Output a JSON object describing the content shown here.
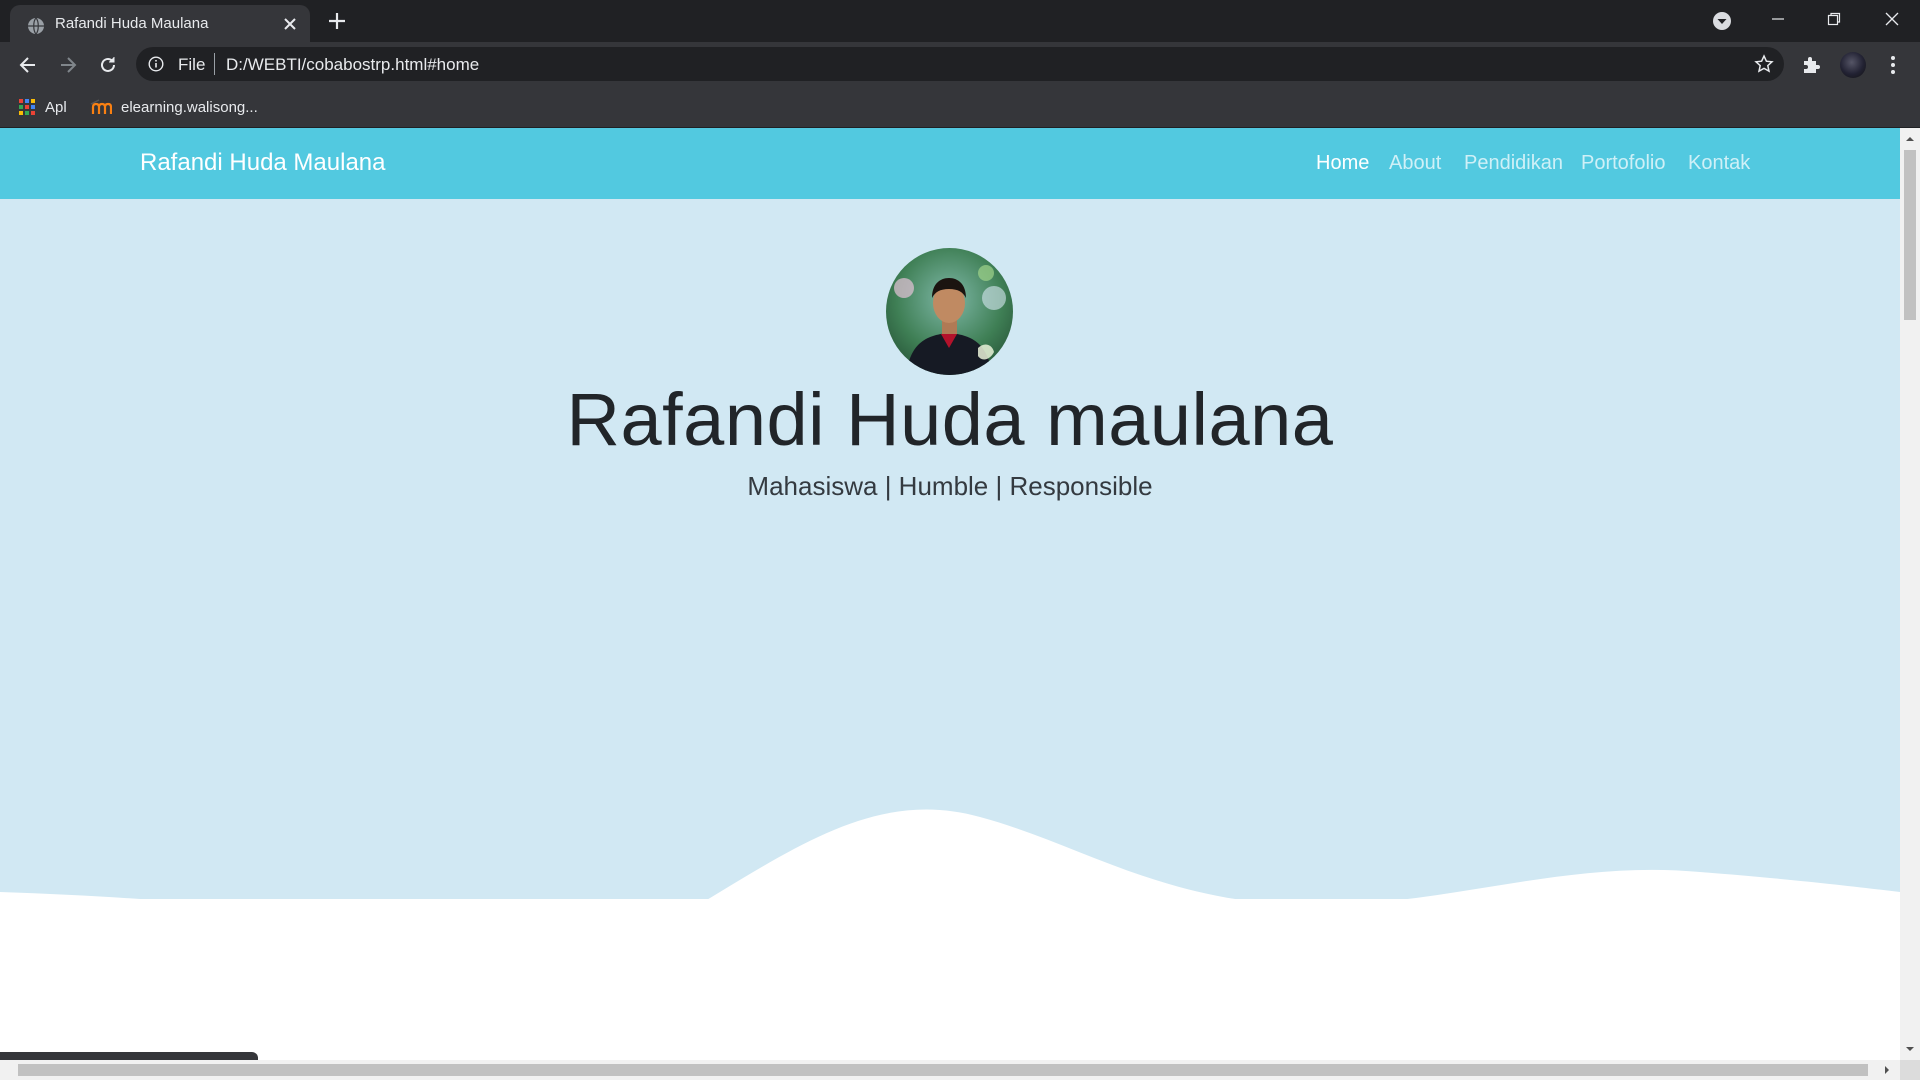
{
  "browser": {
    "tab_title": "Rafandi Huda Maulana",
    "address_scheme": "File",
    "address_url": "D:/WEBTI/cobabostrp.html#home",
    "bookmarks": [
      {
        "label": "Apl",
        "icon": "apps-grid-icon"
      },
      {
        "label": "elearning.walisong...",
        "icon": "moodle-icon"
      }
    ],
    "status_url": "file:///D:/WEBTI/cobabostrp.html#home"
  },
  "site": {
    "brand": "Rafandi Huda Maulana",
    "nav": [
      {
        "label": "Home",
        "active": true
      },
      {
        "label": "About",
        "active": false
      },
      {
        "label": "Pendidikan",
        "active": false
      },
      {
        "label": "Portofolio",
        "active": false
      },
      {
        "label": "Kontak",
        "active": false
      }
    ],
    "hero_name": "Rafandi Huda maulana",
    "hero_subtitle": "Mahasiswa | Humble | Responsible"
  },
  "colors": {
    "navbar": "#52c9e0",
    "jumbotron": "#d1e8f3",
    "chrome_dark": "#202124",
    "chrome_toolbar": "#35363a"
  }
}
